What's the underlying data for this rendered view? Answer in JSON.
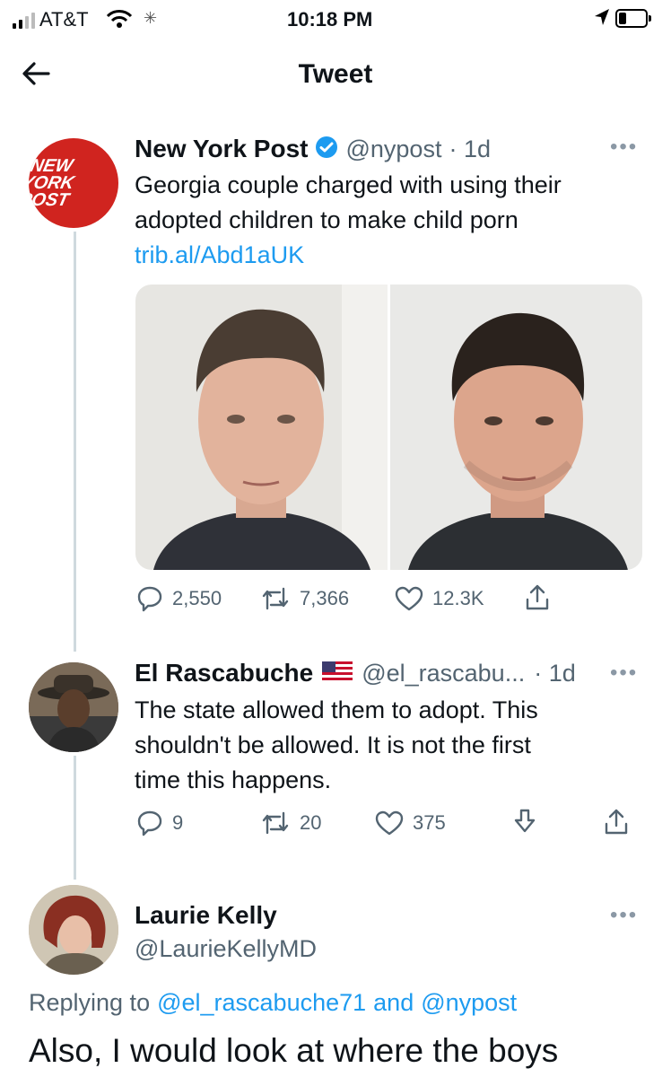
{
  "status_bar": {
    "carrier": "AT&T",
    "time": "10:18 PM"
  },
  "header": {
    "title": "Tweet"
  },
  "tweet1": {
    "logo_text": "NEW YORK POST",
    "name": "New York Post",
    "handle": "@nypost",
    "time": "· 1d",
    "text_lines": [
      "Georgia couple charged with using their",
      "adopted children to make child porn"
    ],
    "link": "trib.al/Abd1aUK",
    "replies": "2,550",
    "retweets": "7,366",
    "likes": "12.3K"
  },
  "tweet2": {
    "name": "El Rascabuche",
    "flag_icon": "us-flag-icon",
    "handle": "@el_rascabu...",
    "time": "· 1d",
    "text_lines": [
      "The state allowed them to adopt. This",
      "shouldn't be allowed. It is not the first",
      "time this happens."
    ],
    "replies": "9",
    "retweets": "20",
    "likes": "375"
  },
  "tweet3": {
    "name": "Laurie Kelly",
    "handle": "@LaurieKellyMD",
    "replying_prefix": "Replying to",
    "replying_user1": "@el_rascabuche71",
    "replying_and": "and",
    "replying_user2": "@nypost",
    "text": "Also, I would look at where the boys"
  },
  "colors": {
    "link": "#1d9bf0",
    "secondary": "#536471",
    "nypost_red": "#d0241f",
    "verified": "#1d9bf0"
  }
}
